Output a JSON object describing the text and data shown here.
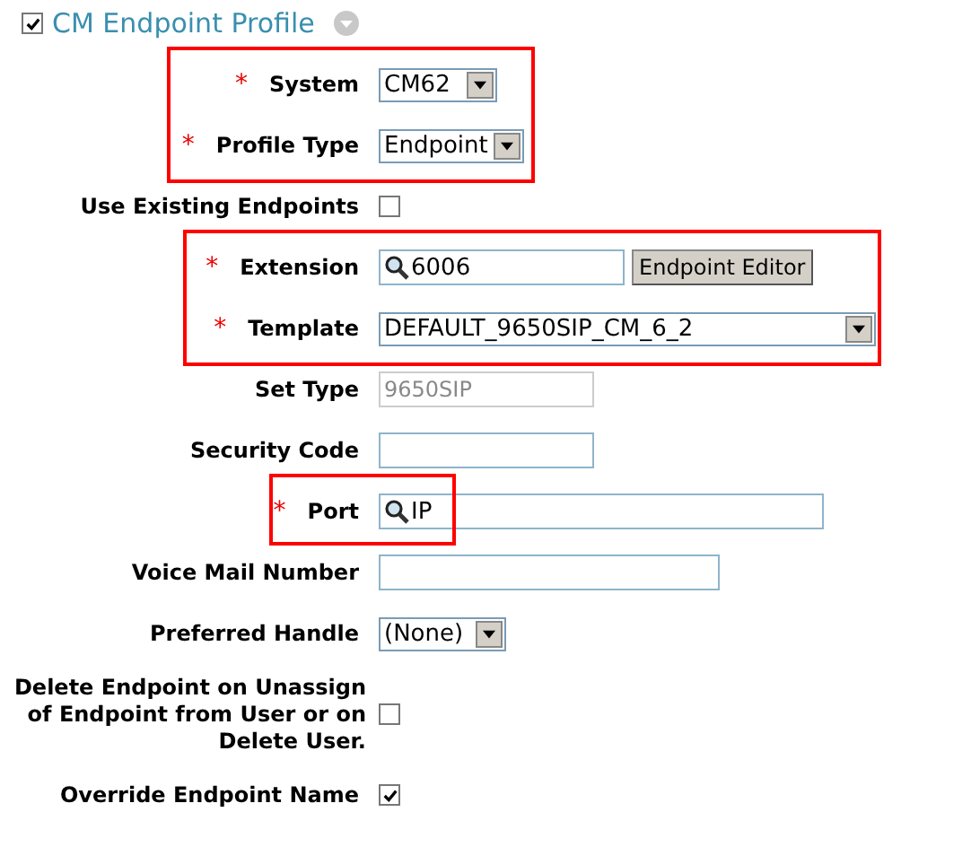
{
  "section": {
    "title": "CM Endpoint Profile",
    "checked": true
  },
  "groups": [
    {
      "highlighted": true,
      "rows": [
        {
          "kind": "select",
          "marker": "*",
          "label": "System",
          "value": "CM62"
        },
        {
          "kind": "select",
          "marker": "*",
          "label": "Profile Type",
          "value": "Endpoint"
        }
      ]
    },
    {
      "highlighted": false,
      "rows": [
        {
          "kind": "checkbox",
          "label": "Use Existing Endpoints",
          "checked": false
        }
      ]
    },
    {
      "highlighted": true,
      "rows": [
        {
          "kind": "search",
          "marker": "*",
          "label": "Extension",
          "value": "6006",
          "button": "Endpoint Editor"
        },
        {
          "kind": "select",
          "marker": "*",
          "label": "Template",
          "value": "DEFAULT_9650SIP_CM_6_2"
        }
      ]
    },
    {
      "highlighted": false,
      "rows": [
        {
          "kind": "text",
          "label": "Set Type",
          "value": "9650SIP",
          "disabled": true
        },
        {
          "kind": "text",
          "label": "Security Code",
          "disabled": false
        }
      ]
    },
    {
      "highlighted": true,
      "rows": [
        {
          "kind": "search",
          "marker": "*",
          "label": "Port",
          "value": "IP"
        }
      ]
    },
    {
      "highlighted": false,
      "rows": [
        {
          "kind": "text",
          "label": "Voice Mail Number",
          "disabled": false
        },
        {
          "kind": "select",
          "label": "Preferred Handle",
          "value": "(None)"
        },
        {
          "kind": "checkbox",
          "label": "Delete Endpoint on Unassign of Endpoint from User or on Delete User.",
          "checked": false
        },
        {
          "kind": "checkbox",
          "label": "Override Endpoint Name",
          "checked": true
        }
      ]
    }
  ]
}
